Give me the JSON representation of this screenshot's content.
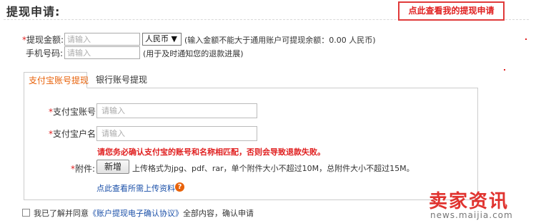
{
  "header": {
    "title": "提现申请:",
    "view_button": "点此查看我的提现申请"
  },
  "form": {
    "amount": {
      "required_mark": "*",
      "label": "提现金额:",
      "placeholder": "请输入",
      "currency": "人民币 ▼",
      "hint": "(输入金额不能大于通用账户可提现余额：0.00 人民币)"
    },
    "phone": {
      "label": "手机号码:",
      "placeholder": "请输入",
      "hint": "(用于及时通知您的退款进展)"
    }
  },
  "tabs": [
    {
      "label": "支付宝账号提现",
      "active": true
    },
    {
      "label": "银行账号提现",
      "active": false
    }
  ],
  "alipay": {
    "account": {
      "required_mark": "*",
      "label": "支付宝账号:",
      "placeholder": "请输入"
    },
    "name": {
      "required_mark": "*",
      "label": "支付宝户名:",
      "placeholder": "请输入"
    },
    "warning": "请您务必确认支付宝的账号和名称相匹配，否则会导致退款失败。",
    "attachment": {
      "required_mark": "*",
      "label": "附件:",
      "add_button": "新增",
      "hint": "上传格式为jpg、pdf、rar，单个附件大小不超过10M，总附件大小不超过15M。"
    },
    "materials_link": "点此查看所需上传资料",
    "help_icon": "?"
  },
  "agreement": {
    "prefix": "我已了解并同意",
    "link": "《账户提现电子确认协议》",
    "suffix": "全部内容，确认申请"
  },
  "watermark": {
    "main": "卖家资讯",
    "sub": "news.maijia.com"
  },
  "colors": {
    "accent_red": "#e02020",
    "tab_orange": "#e8620a",
    "link_blue": "#1a4fa8"
  }
}
